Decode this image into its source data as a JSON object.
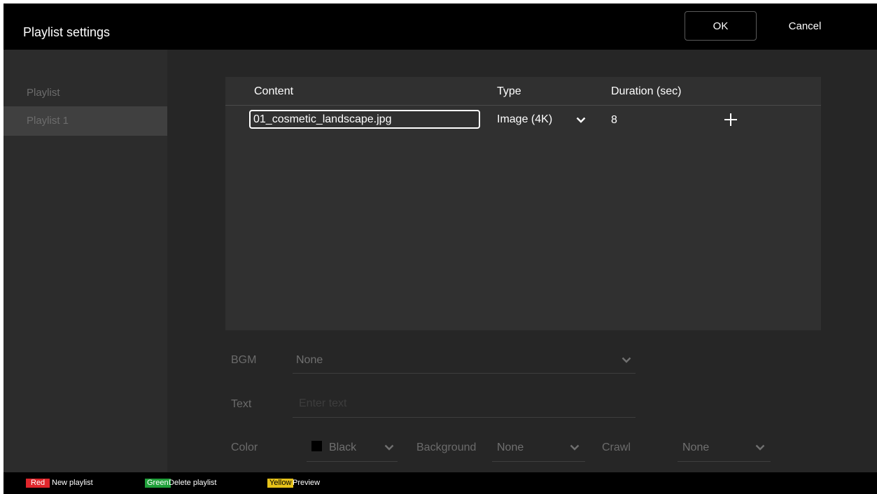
{
  "header": {
    "title": "Playlist settings",
    "ok_label": "OK",
    "cancel_label": "Cancel"
  },
  "sidebar": {
    "heading": "Playlist",
    "items": [
      {
        "label": "Playlist 1",
        "selected": true
      }
    ]
  },
  "table": {
    "columns": [
      "Content",
      "Type",
      "Duration (sec)"
    ],
    "rows": [
      {
        "content": "01_cosmetic_landscape.jpg",
        "type": "Image (4K)",
        "duration": "8"
      }
    ]
  },
  "form": {
    "bgm_label": "BGM",
    "bgm_value": "None",
    "text_label": "Text",
    "text_placeholder": "Enter text",
    "color_label": "Color",
    "color_value": "Black",
    "color_swatch": "#000000",
    "background_label": "Background",
    "background_value": "None",
    "crawl_label": "Crawl",
    "crawl_value": "None"
  },
  "footer": {
    "red_key": "Red",
    "red_label": "New playlist",
    "green_key": "Green",
    "green_label": "Delete playlist",
    "yellow_key": "Yellow",
    "yellow_label": "Preview"
  },
  "icons": [
    "chevron-down-icon",
    "plus-icon"
  ],
  "colors": {
    "accent_red": "#e0262c",
    "accent_green": "#20a03a",
    "accent_yellow": "#e6c21a"
  }
}
